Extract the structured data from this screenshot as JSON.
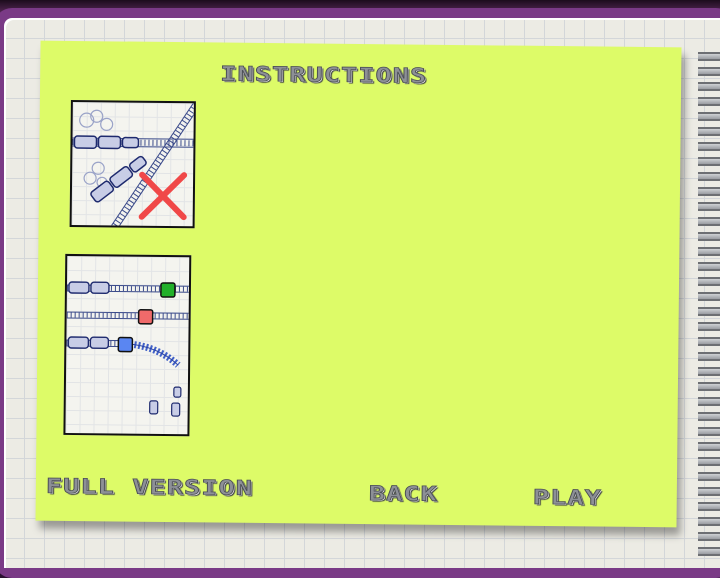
{
  "screen": {
    "title": "INSTRUCTIONS"
  },
  "illustrations": {
    "crash": {
      "marker_icon": "red-x-icon",
      "marker_color": "#f04848"
    },
    "switches": {
      "signal_colors": [
        "#22b02a",
        "#f06a6a",
        "#5a86f2"
      ]
    }
  },
  "buttons": {
    "full_version": "FULL VERSION",
    "back": "BACK",
    "play": "PLAY"
  },
  "colors": {
    "panel": "#ddfb68",
    "frame": "#7a3a86",
    "paper": "#ecebe4"
  }
}
